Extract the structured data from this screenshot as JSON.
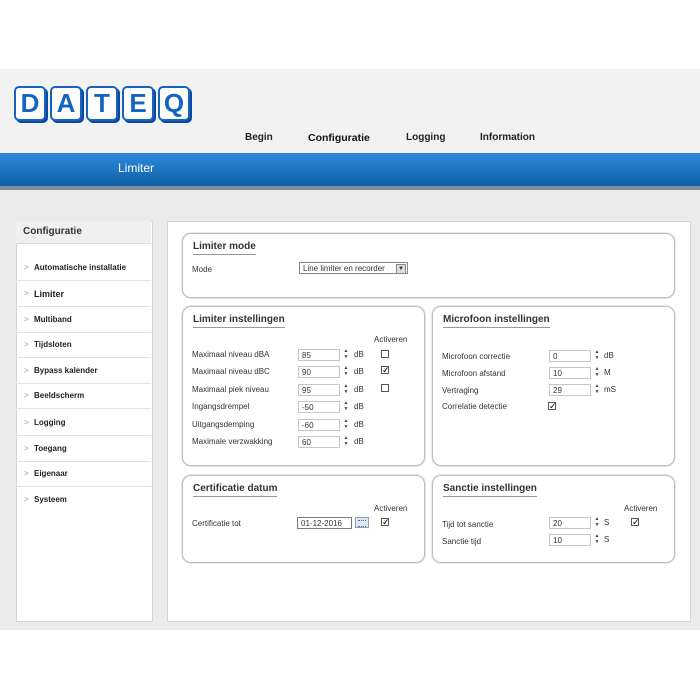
{
  "logo": {
    "letters": [
      "D",
      "A",
      "T",
      "E",
      "Q"
    ],
    "color": "#1565c0"
  },
  "nav": {
    "begin": "Begin",
    "configuratie": "Configuratie",
    "logging": "Logging",
    "information": "Information"
  },
  "bar": {
    "title": "Limiter",
    "color": "#1a72c3"
  },
  "sidebar": {
    "title": "Configuratie",
    "items": [
      {
        "label": "Automatische installatie"
      },
      {
        "label": "Limiter"
      },
      {
        "label": "Multiband"
      },
      {
        "label": "Tijdsloten"
      },
      {
        "label": "Bypass kalender"
      },
      {
        "label": "Beeldscherm"
      },
      {
        "label": "Logging"
      },
      {
        "label": "Toegang"
      },
      {
        "label": "Eigenaar"
      },
      {
        "label": "Systeem"
      }
    ]
  },
  "limiter_mode": {
    "title": "Limiter mode",
    "mode_label": "Mode",
    "mode_value": "Line limiter en recorder"
  },
  "limiter": {
    "title": "Limiter instellingen",
    "activeren_label": "Activeren",
    "rows": [
      {
        "label": "Maximaal niveau dBA",
        "value": "85",
        "unit": "dB",
        "checked": false
      },
      {
        "label": "Maximaal niveau dBC",
        "value": "90",
        "unit": "dB",
        "checked": true
      },
      {
        "label": "Maximaal piek niveau",
        "value": "95",
        "unit": "dB",
        "checked": false
      },
      {
        "label": "Ingangsdrempel",
        "value": "-50",
        "unit": "dB"
      },
      {
        "label": "Uitgangsdemping",
        "value": "-60",
        "unit": "dB"
      },
      {
        "label": "Maximale verzwakking",
        "value": "60",
        "unit": "dB"
      }
    ]
  },
  "microfoon": {
    "title": "Microfoon instellingen",
    "rows": [
      {
        "label": "Microfoon correctie",
        "value": "0",
        "unit": "dB"
      },
      {
        "label": "Microfoon afstand",
        "value": "10",
        "unit": "M"
      },
      {
        "label": "Vertraging",
        "value": "29",
        "unit": "mS"
      }
    ],
    "correlatie_label": "Correlatie detectie",
    "correlatie_checked": true
  },
  "certificatie": {
    "title": "Certificatie datum",
    "activeren_label": "Activeren",
    "label": "Certificatie tot",
    "value": "01-12-2016",
    "checked": true
  },
  "sanctie": {
    "title": "Sanctie instellingen",
    "activeren_label": "Activeren",
    "rows": [
      {
        "label": "Tijd tot sanctie",
        "value": "20",
        "unit": "S"
      },
      {
        "label": "Sanctie tijd",
        "value": "10",
        "unit": "S"
      }
    ],
    "checked": true
  }
}
